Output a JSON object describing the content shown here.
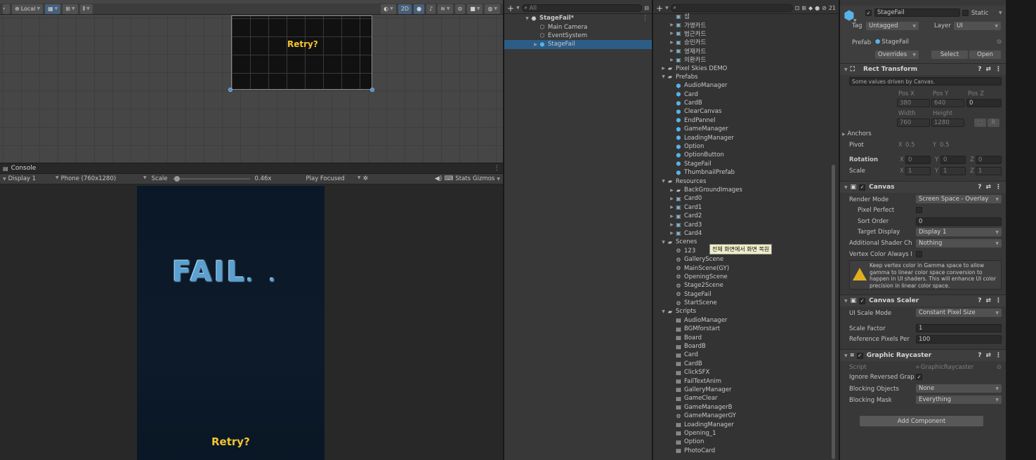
{
  "scene": {
    "toolbar": {
      "pivot_mode": "Local",
      "mode_2d": "2D"
    },
    "retry_text": "Retry?"
  },
  "console": {
    "tab": "Console"
  },
  "game": {
    "display": "Display 1",
    "resolution": "Phone (760x1280)",
    "scale_label": "Scale",
    "scale_value": "0.46x",
    "scale_fraction": 0.3,
    "play_mode": "Play Focused",
    "stats": "Stats",
    "gizmos": "Gizmos",
    "fail_text": "FAIL",
    "retry_text": "Retry?"
  },
  "hierarchy": {
    "search_placeholder": "All",
    "items": [
      {
        "label": "StageFail*",
        "bold": true,
        "indent": 0,
        "arrow": "▼",
        "icon": "unity-logo-icon"
      },
      {
        "label": "Main Camera",
        "indent": 1,
        "arrow": "",
        "icon": "gameobject-icon"
      },
      {
        "label": "EventSystem",
        "indent": 1,
        "arrow": "",
        "icon": "gameobject-icon"
      },
      {
        "label": "StageFail",
        "indent": 1,
        "arrow": "▶",
        "icon": "prefab-icon",
        "selected": true
      }
    ]
  },
  "project": {
    "search_placeholder": "",
    "hidden_count": "21",
    "tooltip": "전체 화면에서 화면 복원",
    "items": [
      {
        "label": "섬",
        "indent": 1,
        "icon": "image-icon"
      },
      {
        "label": "가영카드",
        "indent": 1,
        "arrow": "▶",
        "icon": "image-icon"
      },
      {
        "label": "범근카드",
        "indent": 1,
        "arrow": "▶",
        "icon": "image-icon"
      },
      {
        "label": "승민카드",
        "indent": 1,
        "arrow": "▶",
        "icon": "image-icon"
      },
      {
        "label": "영재카드",
        "indent": 1,
        "arrow": "▶",
        "icon": "image-icon"
      },
      {
        "label": "의환카드",
        "indent": 1,
        "arrow": "▶",
        "icon": "image-icon"
      },
      {
        "label": "Pixel Skies DEMO",
        "indent": 0,
        "arrow": "▶",
        "icon": "folder-icon"
      },
      {
        "label": "Prefabs",
        "indent": 0,
        "arrow": "▼",
        "icon": "folder-icon"
      },
      {
        "label": "AudioManager",
        "indent": 1,
        "icon": "prefab-icon"
      },
      {
        "label": "Card",
        "indent": 1,
        "icon": "prefab-icon"
      },
      {
        "label": "CardB",
        "indent": 1,
        "icon": "prefab-icon"
      },
      {
        "label": "ClearCanvas",
        "indent": 1,
        "icon": "prefab-icon"
      },
      {
        "label": "EndPannel",
        "indent": 1,
        "icon": "prefab-icon"
      },
      {
        "label": "GameManager",
        "indent": 1,
        "icon": "prefab-icon"
      },
      {
        "label": "LoadingManager",
        "indent": 1,
        "icon": "prefab-icon"
      },
      {
        "label": "Option",
        "indent": 1,
        "icon": "prefab-icon"
      },
      {
        "label": "OptionButton",
        "indent": 1,
        "icon": "prefab-icon"
      },
      {
        "label": "StageFail",
        "indent": 1,
        "icon": "prefab-icon"
      },
      {
        "label": "ThumbnailPrefab",
        "indent": 1,
        "icon": "prefab-icon"
      },
      {
        "label": "Resources",
        "indent": 0,
        "arrow": "▼",
        "icon": "folder-icon"
      },
      {
        "label": "BackGroundImages",
        "indent": 1,
        "arrow": "▶",
        "icon": "folder-icon"
      },
      {
        "label": "Card0",
        "indent": 1,
        "arrow": "▶",
        "icon": "image-icon"
      },
      {
        "label": "Card1",
        "indent": 1,
        "arrow": "▶",
        "icon": "image-icon"
      },
      {
        "label": "Card2",
        "indent": 1,
        "arrow": "▶",
        "icon": "image-icon"
      },
      {
        "label": "Card3",
        "indent": 1,
        "arrow": "▶",
        "icon": "image-icon"
      },
      {
        "label": "Card4",
        "indent": 1,
        "arrow": "▶",
        "icon": "image-icon"
      },
      {
        "label": "Scenes",
        "indent": 0,
        "arrow": "▼",
        "icon": "folder-icon"
      },
      {
        "label": "123",
        "indent": 1,
        "icon": "scene-icon"
      },
      {
        "label": "GalleryScene",
        "indent": 1,
        "icon": "scene-icon"
      },
      {
        "label": "MainScene(GY)",
        "indent": 1,
        "icon": "scene-icon"
      },
      {
        "label": "OpeningScene",
        "indent": 1,
        "icon": "scene-icon"
      },
      {
        "label": "Stage2Scene",
        "indent": 1,
        "icon": "scene-icon"
      },
      {
        "label": "StageFail",
        "indent": 1,
        "icon": "scene-icon"
      },
      {
        "label": "StartScene",
        "indent": 1,
        "icon": "scene-icon"
      },
      {
        "label": "Scripts",
        "indent": 0,
        "arrow": "▼",
        "icon": "folder-icon"
      },
      {
        "label": "AudioManager",
        "indent": 1,
        "icon": "script-icon"
      },
      {
        "label": "BGMforstart",
        "indent": 1,
        "icon": "script-icon"
      },
      {
        "label": "Board",
        "indent": 1,
        "icon": "script-icon"
      },
      {
        "label": "BoardB",
        "indent": 1,
        "icon": "script-icon"
      },
      {
        "label": "Card",
        "indent": 1,
        "icon": "script-icon"
      },
      {
        "label": "CardB",
        "indent": 1,
        "icon": "script-icon"
      },
      {
        "label": "ClickSFX",
        "indent": 1,
        "icon": "script-icon"
      },
      {
        "label": "FailTextAnim",
        "indent": 1,
        "icon": "script-icon"
      },
      {
        "label": "GalleryManager",
        "indent": 1,
        "icon": "script-icon"
      },
      {
        "label": "GameClear",
        "indent": 1,
        "icon": "script-icon"
      },
      {
        "label": "GameManagerB",
        "indent": 1,
        "icon": "script-icon"
      },
      {
        "label": "GameManagerGY",
        "indent": 1,
        "icon": "gear-icon"
      },
      {
        "label": "LoadingManager",
        "indent": 1,
        "icon": "script-icon"
      },
      {
        "label": "Opening_1",
        "indent": 1,
        "icon": "script-icon"
      },
      {
        "label": "Option",
        "indent": 1,
        "icon": "script-icon"
      },
      {
        "label": "PhotoCard",
        "indent": 1,
        "icon": "script-icon"
      }
    ]
  },
  "inspector": {
    "object_name": "StageFail",
    "static_label": "Static",
    "tag_label": "Tag",
    "tag_value": "Untagged",
    "layer_label": "Layer",
    "layer_value": "UI",
    "prefab_label": "Prefab",
    "prefab_value": "StageFail",
    "overrides": "Overrides",
    "select": "Select",
    "open": "Open",
    "rect": {
      "title": "Rect Transform",
      "note": "Some values driven by Canvas.",
      "posx_label": "Pos X",
      "posx": "380",
      "posy_label": "Pos Y",
      "posy": "640",
      "posz_label": "Pos Z",
      "posz": "0",
      "width_label": "Width",
      "width": "760",
      "height_label": "Height",
      "height": "1280",
      "r_btn": "R",
      "anchors": "Anchors",
      "pivot": "Pivot",
      "pivot_x": "0.5",
      "pivot_y": "0.5",
      "rotation": "Rotation",
      "rot_x": "0",
      "rot_y": "0",
      "rot_z": "0",
      "scale": "Scale",
      "scale_x": "1",
      "scale_y": "1",
      "scale_z": "1",
      "x": "X",
      "y": "Y",
      "z": "Z"
    },
    "canvas": {
      "title": "Canvas",
      "render_mode_label": "Render Mode",
      "render_mode": "Screen Space - Overlay",
      "pixel_perfect": "Pixel Perfect",
      "sort_order_label": "Sort Order",
      "sort_order": "0",
      "target_display_label": "Target Display",
      "target_display": "Display 1",
      "shader_ch_label": "Additional Shader Ch",
      "shader_ch": "Nothing",
      "vertex_color_label": "Vertex Color Always I",
      "warning": "Keep vertex color in Gamma space to allow gamma to linear color space conversion to happen in UI shaders. This will enhance UI color precision in linear color space."
    },
    "scaler": {
      "title": "Canvas Scaler",
      "mode_label": "UI Scale Mode",
      "mode": "Constant Pixel Size",
      "factor_label": "Scale Factor",
      "factor": "1",
      "ref_label": "Reference Pixels Per",
      "ref": "100"
    },
    "raycaster": {
      "title": "Graphic Raycaster",
      "script_label": "Script",
      "script": "GraphicRaycaster",
      "ignore_label": "Ignore Reversed Grap",
      "blocking_label": "Blocking Objects",
      "blocking": "None",
      "mask_label": "Blocking Mask",
      "mask": "Everything"
    },
    "add_component": "Add Component"
  },
  "colors": {
    "accent": "#46607c",
    "selection": "#2c5d87",
    "retry_yellow": "#f4c430",
    "fail_blue": "#5aa0d0"
  }
}
